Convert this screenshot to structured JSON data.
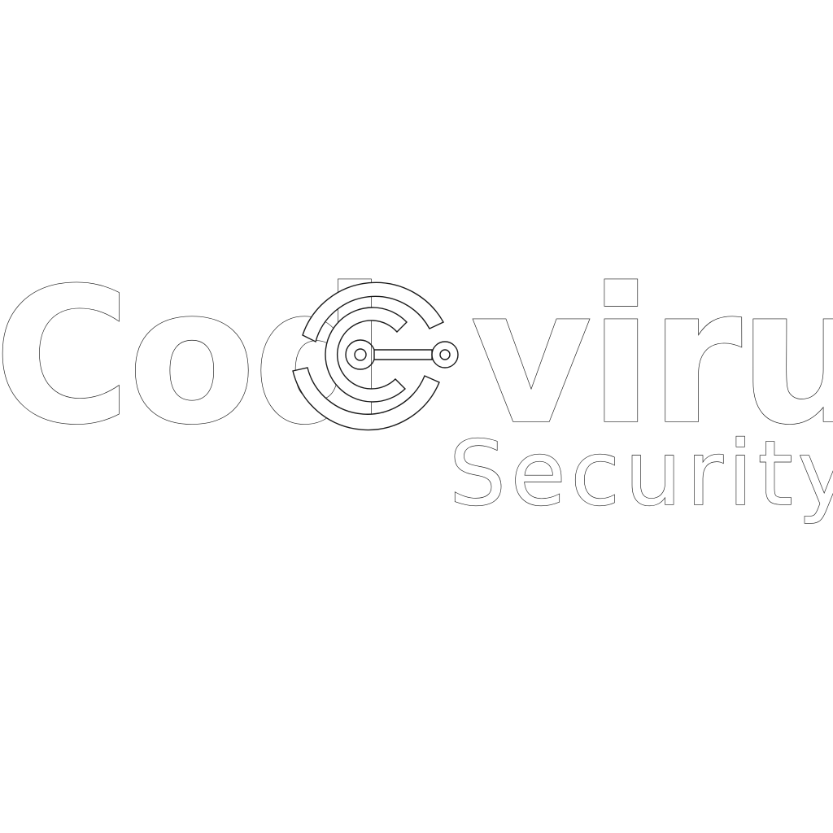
{
  "logo": {
    "brand_left": "Cod",
    "brand_right": "virus",
    "tagline": "Security",
    "emblem_icon": "target-node-icon",
    "colors": {
      "background": "#ffffff",
      "outline": "#1a1a1a"
    }
  }
}
